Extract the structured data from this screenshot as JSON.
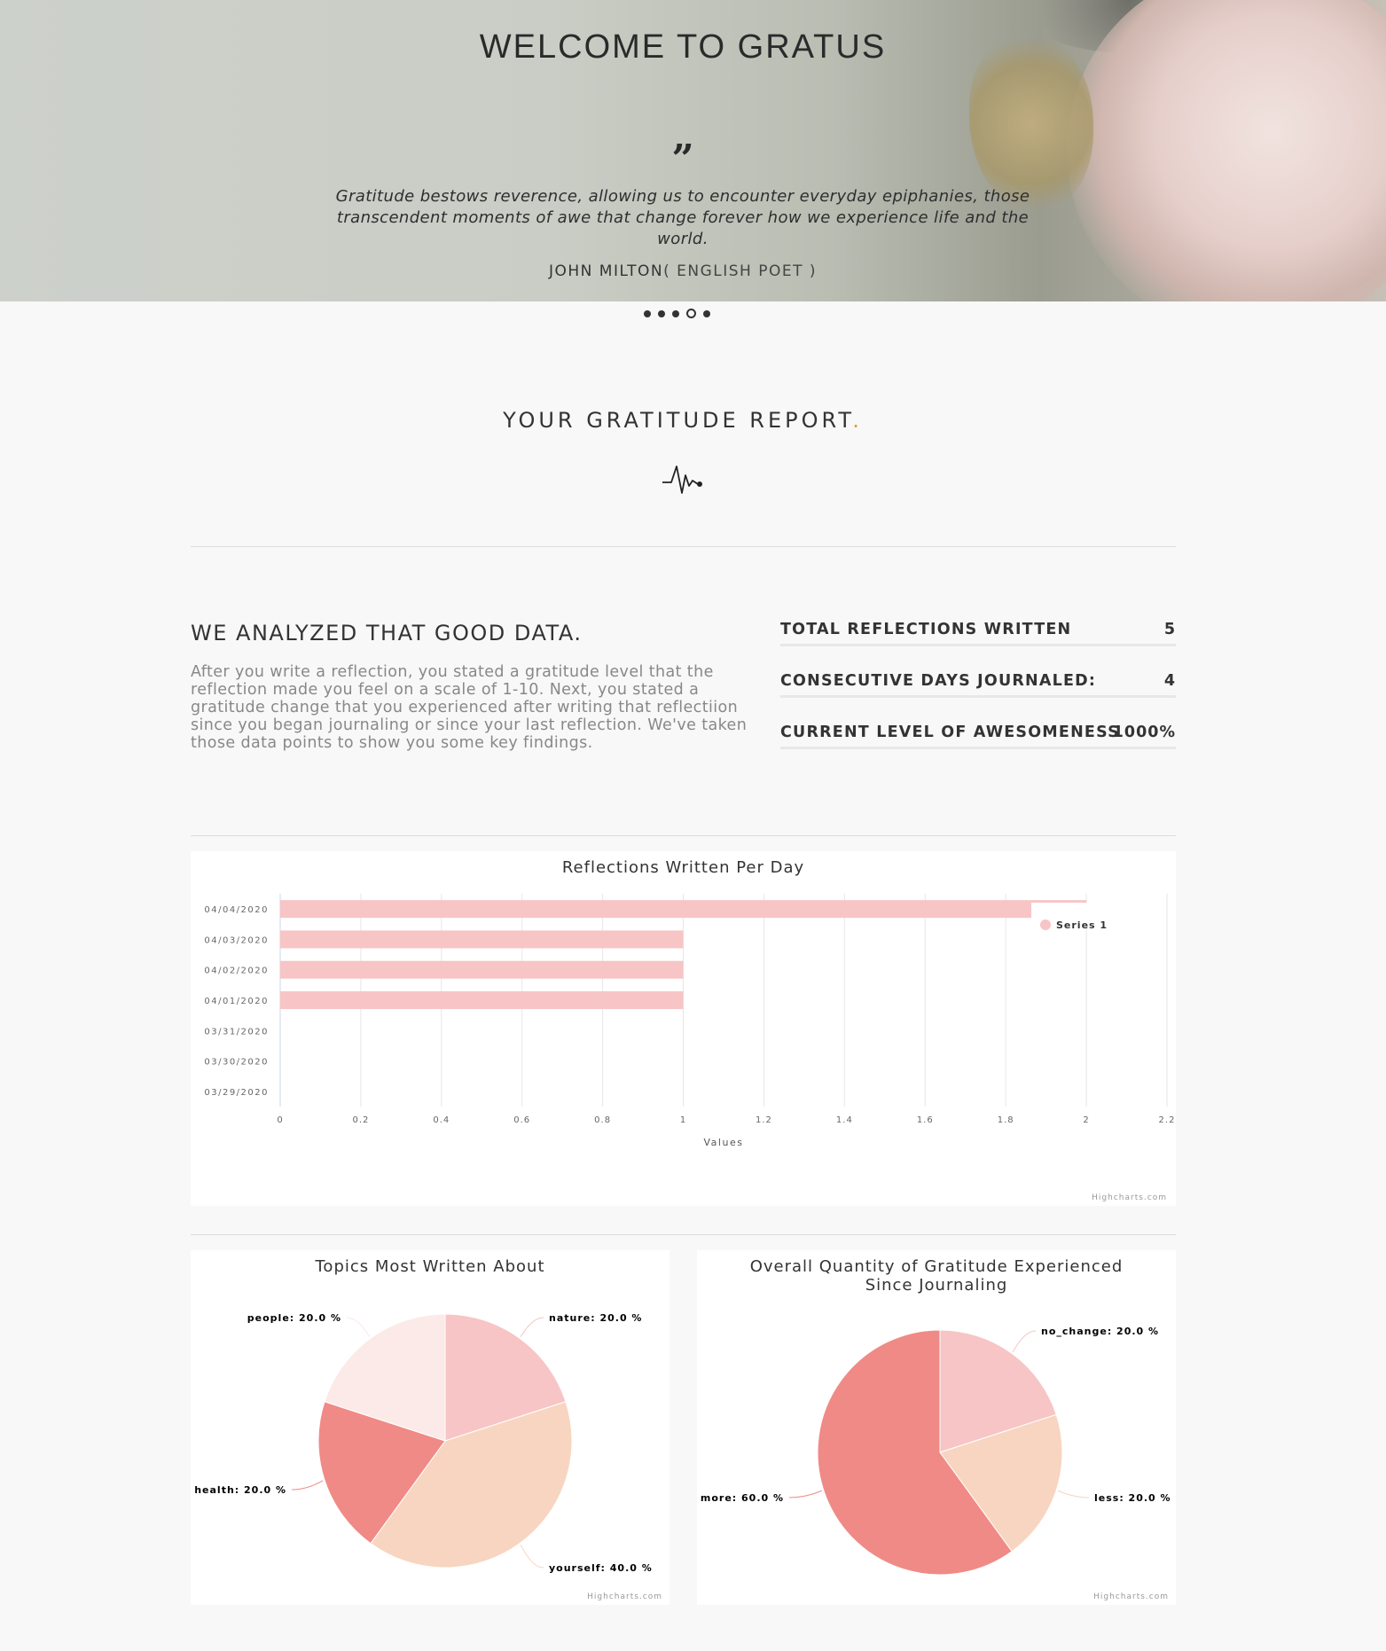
{
  "hero": {
    "title": "WELCOME TO GRATUS",
    "quote_icon": "quote-icon",
    "quote": "Gratitude bestows reverence, allowing us to encounter everyday epiphanies, those transcendent moments of awe that change forever how we experience life and the world.",
    "author": "JOHN MILTON",
    "author_role": "( ENGLISH POET )",
    "slides": 5,
    "active_slide": 4
  },
  "report": {
    "title": "YOUR GRATITUDE REPORT",
    "title_accent": ".",
    "icon": "pulse-icon"
  },
  "analysis": {
    "title": "WE ANALYZED THAT GOOD DATA.",
    "body": "After you write a reflection, you stated a gratitude level that the reflection made you feel on a scale of 1-10. Next, you stated a gratitude change that you experienced after writing that reflectiion since you began journaling or since your last reflection. We've taken those data points to show you some key findings."
  },
  "stats": [
    {
      "label": "TOTAL REFLECTIONS WRITTEN",
      "value": "5"
    },
    {
      "label": "CONSECUTIVE DAYS JOURNALED:",
      "value": "4"
    },
    {
      "label": "CURRENT LEVEL OF AWESOMENESS",
      "value": "1000%"
    }
  ],
  "credits": "Highcharts.com",
  "colors": {
    "accent": "#e0a030",
    "pink": "#f7c5c5",
    "peach": "#f8d5c0",
    "light_pink": "#fbeae7",
    "salmon": "#f08a86"
  },
  "chart_data": [
    {
      "type": "bar",
      "title": "Reflections Written Per Day",
      "categories": [
        "04/04/2020",
        "04/03/2020",
        "04/02/2020",
        "04/01/2020",
        "03/31/2020",
        "03/30/2020",
        "03/29/2020"
      ],
      "series": [
        {
          "name": "Series 1",
          "values": [
            2,
            1,
            1,
            1,
            0,
            0,
            0
          ]
        }
      ],
      "xlabel": "Values",
      "xlim": [
        0,
        2.2
      ],
      "ticks": [
        "0",
        "0.2",
        "0.4",
        "0.6",
        "0.8",
        "1",
        "1.2",
        "1.4",
        "1.6",
        "1.8",
        "2",
        "2.2"
      ],
      "legend": "top-right"
    },
    {
      "type": "pie",
      "title": "Topics Most Written About",
      "slices": [
        {
          "name": "nature",
          "value": 20.0,
          "label": "nature: 20.0 %",
          "color": "#f7c5c5"
        },
        {
          "name": "yourself",
          "value": 40.0,
          "label": "yourself: 40.0 %",
          "color": "#f8d5c0"
        },
        {
          "name": "health",
          "value": 20.0,
          "label": "health: 20.0 %",
          "color": "#f08a86"
        },
        {
          "name": "people",
          "value": 20.0,
          "label": "people: 20.0 %",
          "color": "#fbeae7"
        }
      ]
    },
    {
      "type": "pie",
      "title": "Overall Quantity of Gratitude Experienced Since Journaling",
      "slices": [
        {
          "name": "no_change",
          "value": 20.0,
          "label": "no_change: 20.0 %",
          "color": "#f7c5c5"
        },
        {
          "name": "less",
          "value": 20.0,
          "label": "less: 20.0 %",
          "color": "#f8d5c0"
        },
        {
          "name": "more",
          "value": 60.0,
          "label": "more: 60.0 %",
          "color": "#f08a86"
        }
      ]
    }
  ]
}
